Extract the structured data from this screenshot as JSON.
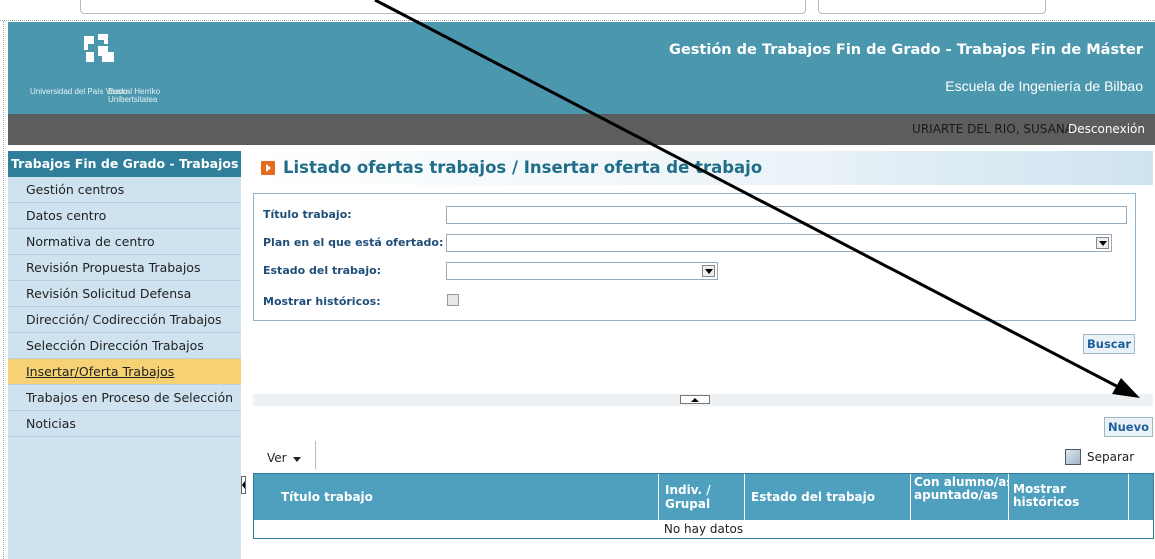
{
  "header": {
    "app_title": "Gestión de Trabajos Fin de Grado - Trabajos Fin de Máster",
    "school": "Escuela de Ingeniería de Bilbao",
    "logo_text_es": "Universidad del País Vasco",
    "logo_text_eu": "Euskal Herriko Unibertsitatea"
  },
  "userbar": {
    "user_name": "URIARTE DEL RIO, SUSANA",
    "logout_label": "Desconexión"
  },
  "sidebar": {
    "section_title": "Trabajos Fin de Grado - Trabajos Fin de Máster",
    "items": [
      {
        "label": "Gestión centros"
      },
      {
        "label": "Datos centro"
      },
      {
        "label": "Normativa de centro"
      },
      {
        "label": "Revisión Propuesta Trabajos"
      },
      {
        "label": "Revisión Solicitud Defensa"
      },
      {
        "label": "Dirección/ Codirección Trabajos"
      },
      {
        "label": "Selección Dirección Trabajos"
      },
      {
        "label": "Insertar/Oferta Trabajos",
        "active": true
      },
      {
        "label": "Trabajos en Proceso de Selección"
      },
      {
        "label": "Noticias"
      }
    ]
  },
  "main": {
    "page_title": "Listado ofertas trabajos / Insertar oferta de trabajo",
    "filters": {
      "titulo_label": "Título trabajo:",
      "titulo_value": "",
      "plan_label": "Plan en el que está ofertado:",
      "plan_value": "",
      "estado_label": "Estado del trabajo:",
      "estado_value": "",
      "historicos_label": "Mostrar históricos:",
      "historicos_checked": false
    },
    "search_button": "Buscar",
    "new_button": "Nuevo",
    "toolbar": {
      "view_label": "Ver",
      "detach_label": "Separar"
    },
    "grid": {
      "columns": [
        "Título trabajo",
        "Indiv. / Grupal",
        "Estado del trabajo",
        "Con alumno/as apuntado/as",
        "Mostrar históricos"
      ],
      "empty_text": "No hay datos"
    }
  },
  "colors": {
    "banner": "#4a97ae",
    "userbar": "#5b5d5e",
    "sidebar_bg": "#cfe2ef",
    "sidebar_active": "#f7d274",
    "grid_header": "#4fa0bf",
    "title_text": "#1f6d88"
  }
}
